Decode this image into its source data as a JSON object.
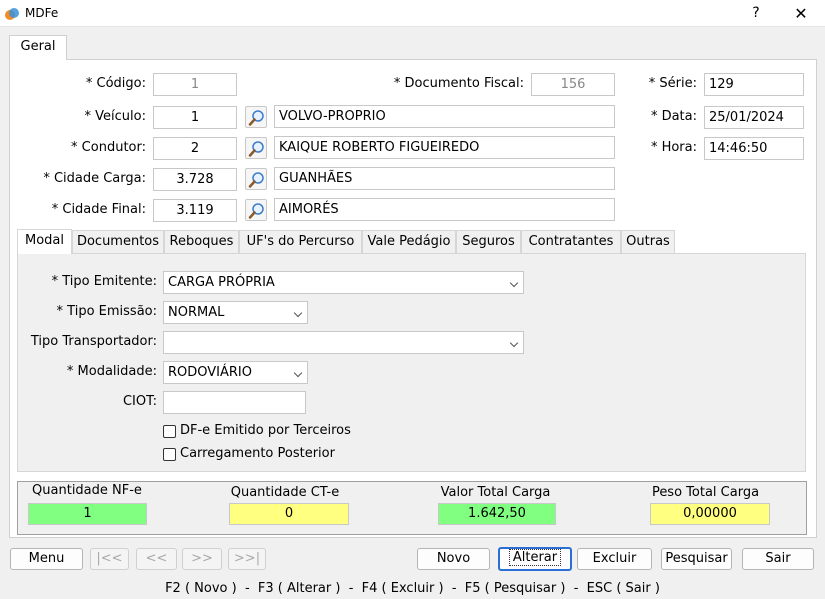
{
  "window": {
    "title": "MDFe",
    "help_label": "?",
    "close_label": "✕"
  },
  "main_tab": "Geral",
  "fields": {
    "codigo": {
      "label": "* Código:",
      "value": "1"
    },
    "documento_fiscal": {
      "label": "* Documento Fiscal:",
      "value": "156"
    },
    "serie": {
      "label": "* Série:",
      "value": "129"
    },
    "veiculo": {
      "label": "* Veículo:",
      "code": "1",
      "name": "VOLVO-PROPRIO"
    },
    "data": {
      "label": "* Data:",
      "value": "25/01/2024"
    },
    "condutor": {
      "label": "* Condutor:",
      "code": "2",
      "name": "KAIQUE ROBERTO FIGUEIREDO"
    },
    "hora": {
      "label": "* Hora:",
      "value": "14:46:50"
    },
    "cidade_carga": {
      "label": "* Cidade Carga:",
      "code": "3.728",
      "name": "GUANHÃES"
    },
    "cidade_final": {
      "label": "* Cidade Final:",
      "code": "3.119",
      "name": "AIMORÉS"
    }
  },
  "subtabs": [
    "Modal",
    "Documentos",
    "Reboques",
    "UF's do Percurso",
    "Vale Pedágio",
    "Seguros",
    "Contratantes",
    "Outras"
  ],
  "modal": {
    "tipo_emitente": {
      "label": "* Tipo Emitente:",
      "value": "CARGA PRÓPRIA"
    },
    "tipo_emissao": {
      "label": "* Tipo Emissão:",
      "value": "NORMAL"
    },
    "tipo_transportador": {
      "label": "Tipo Transportador:",
      "value": ""
    },
    "modalidade": {
      "label": "* Modalidade:",
      "value": "RODOVIÁRIO"
    },
    "ciot": {
      "label": "CIOT:",
      "value": ""
    },
    "dfe_terceiros": {
      "label": "DF-e Emitido por Terceiros",
      "checked": false
    },
    "carregamento_posterior": {
      "label": "Carregamento Posterior",
      "checked": false
    }
  },
  "totals": {
    "qtd_nfe": {
      "label": "Quantidade NF-e",
      "value": "1"
    },
    "qtd_cte": {
      "label": "Quantidade CT-e",
      "value": "0"
    },
    "valor_total": {
      "label": "Valor Total Carga",
      "value": "1.642,50"
    },
    "peso_total": {
      "label": "Peso Total Carga",
      "value": "0,00000"
    }
  },
  "buttons": {
    "menu": "Menu",
    "first": "|<<",
    "prev": "<<",
    "next": ">>",
    "last": ">>|",
    "novo": "Novo",
    "alterar": "Alterar",
    "excluir": "Excluir",
    "pesquisar": "Pesquisar",
    "sair": "Sair"
  },
  "status_bar": "F2 ( Novo )  -  F3 ( Alterar )  -  F4 ( Excluir )  -  F5 ( Pesquisar )  -  ESC ( Sair )",
  "colors": {
    "green": "#80ff80",
    "yellow": "#ffff80",
    "focus": "#2a6fd6"
  }
}
